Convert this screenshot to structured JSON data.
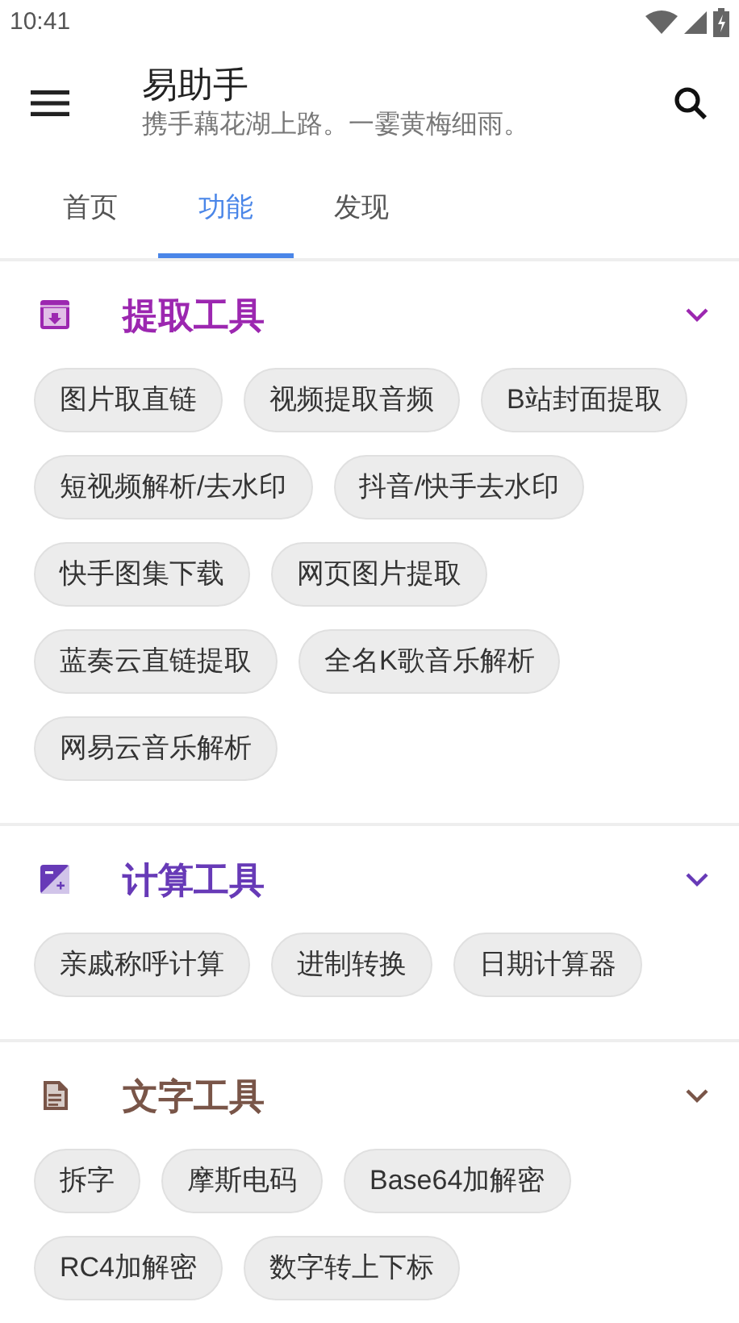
{
  "status_bar": {
    "time": "10:41"
  },
  "toolbar": {
    "title": "易助手",
    "subtitle": "携手藕花湖上路。一霎黄梅细雨。"
  },
  "tabs": [
    {
      "label": "首页",
      "selected": false
    },
    {
      "label": "功能",
      "selected": true
    },
    {
      "label": "发现",
      "selected": false
    }
  ],
  "sections": [
    {
      "kind": "extract",
      "title": "提取工具",
      "color": "#9c27b0",
      "expanded": true,
      "chips": [
        "图片取直链",
        "视频提取音频",
        "B站封面提取",
        "短视频解析/去水印",
        "抖音/快手去水印",
        "快手图集下载",
        "网页图片提取",
        "蓝奏云直链提取",
        "全名K歌音乐解析",
        "网易云音乐解析"
      ]
    },
    {
      "kind": "calc",
      "title": "计算工具",
      "color": "#673ab7",
      "expanded": true,
      "chips": [
        "亲戚称呼计算",
        "进制转换",
        "日期计算器"
      ]
    },
    {
      "kind": "text",
      "title": "文字工具",
      "color": "#795548",
      "expanded": true,
      "chips": [
        "拆字",
        "摩斯电码",
        "Base64加解密",
        "RC4加解密",
        "数字转上下标"
      ]
    }
  ]
}
